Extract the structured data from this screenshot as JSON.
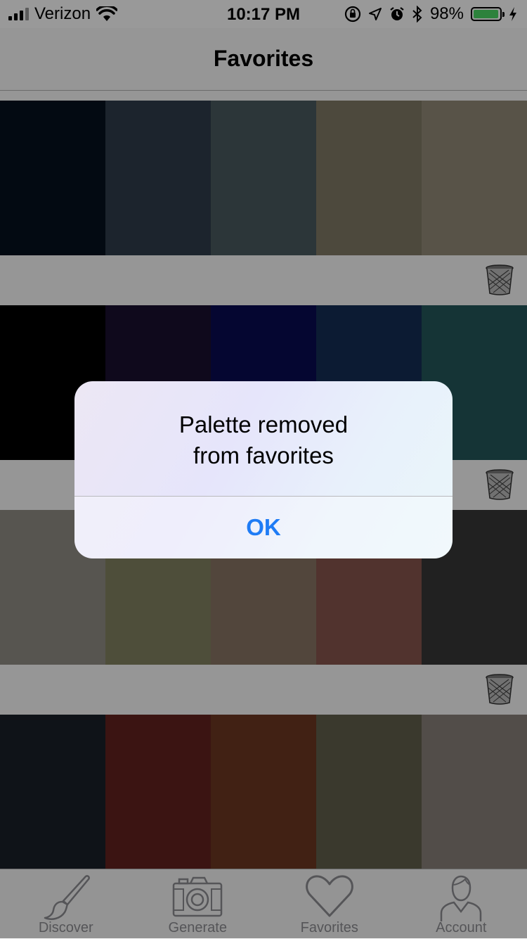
{
  "status_bar": {
    "carrier": "Verizon",
    "time": "10:17 PM",
    "battery_percent": "98%",
    "battery_level": 0.98,
    "icons": [
      "signal-icon",
      "wifi-icon",
      "orientation-lock-icon",
      "location-icon",
      "alarm-icon",
      "bluetooth-icon",
      "battery-icon",
      "charging-icon"
    ]
  },
  "nav": {
    "title": "Favorites"
  },
  "palettes": [
    {
      "colors": [
        "#05111f",
        "#2f3c4b",
        "#4a5a60",
        "#817a66",
        "#938a78"
      ]
    },
    {
      "colors": [
        "#000000",
        "#1a0f30",
        "#090b52",
        "#152d55",
        "#23575a"
      ]
    },
    {
      "colors": [
        "#928e86",
        "#838361",
        "#897664",
        "#87564e",
        "#373737"
      ]
    },
    {
      "colors": [
        "#192028",
        "#63221f",
        "#6d3822",
        "#62604b",
        "#89817a"
      ]
    }
  ],
  "tabs": [
    {
      "label": "Discover",
      "icon": "paintbrush-icon"
    },
    {
      "label": "Generate",
      "icon": "camera-icon"
    },
    {
      "label": "Favorites",
      "icon": "heart-icon"
    },
    {
      "label": "Account",
      "icon": "person-icon"
    }
  ],
  "alert": {
    "line1": "Palette removed",
    "line2": "from favorites",
    "button": "OK"
  },
  "colors": {
    "accent": "#1f7cf5",
    "battery": "#4cd964",
    "tab_inactive": "#8e8e93"
  }
}
